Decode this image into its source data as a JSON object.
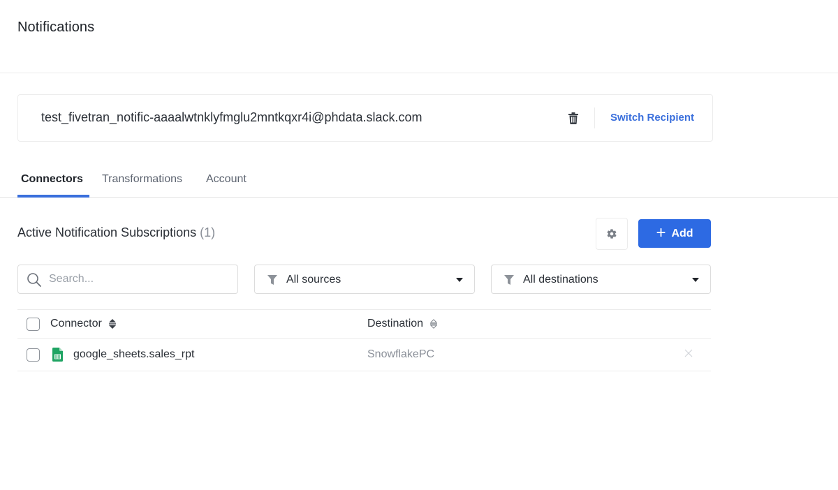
{
  "header": {
    "title": "Notifications"
  },
  "recipient": {
    "email": "test_fivetran_notific-aaaalwtnklyfmglu2mntkqxr4i@phdata.slack.com",
    "delete_icon": "trash-icon",
    "switch_label": "Switch Recipient"
  },
  "tabs": [
    {
      "label": "Connectors",
      "active": true
    },
    {
      "label": "Transformations",
      "active": false
    },
    {
      "label": "Account",
      "active": false
    }
  ],
  "subscriptions": {
    "title": "Active Notification Subscriptions",
    "count": "(1)",
    "settings_icon": "gear-icon",
    "add_label": "Add",
    "add_icon": "plus-icon"
  },
  "filters": {
    "search_placeholder": "Search...",
    "search_value": "",
    "sources_selected": "All sources",
    "destinations_selected": "All destinations"
  },
  "table": {
    "columns": [
      {
        "label": "Connector",
        "sortable": true
      },
      {
        "label": "Destination",
        "sortable": true
      }
    ],
    "rows": [
      {
        "connector": "google_sheets.sales_rpt",
        "connector_icon": "google-sheets-icon",
        "destination": "SnowflakePC",
        "selected": false
      }
    ]
  },
  "colors": {
    "accent": "#2d6ae3",
    "link": "#3a6fdc",
    "sheets_green": "#1fa463"
  }
}
